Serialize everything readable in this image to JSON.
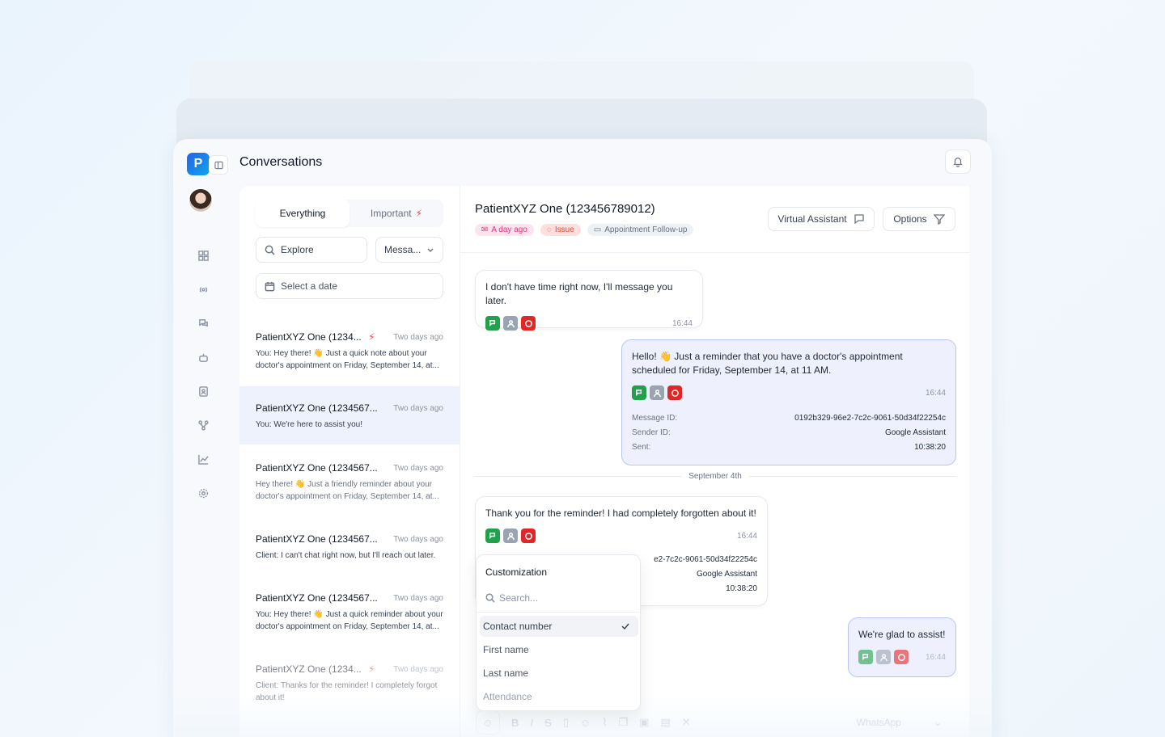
{
  "header": {
    "title": "Conversations",
    "logo_letter": "P"
  },
  "tabs": [
    {
      "label": "Everything"
    },
    {
      "label": "Important"
    }
  ],
  "filters": {
    "explore_label": "Explore",
    "message_select": "Messa...",
    "date_placeholder": "Select a date"
  },
  "conversations": [
    {
      "name": "PatientXYZ One (1234...",
      "time": "Two days ago",
      "important": true,
      "preview": "You: Hey there! 👋 Just a quick note about your doctor's appointment on Friday, September 14, at..."
    },
    {
      "name": "PatientXYZ One (1234567...",
      "time": "Two days ago",
      "important": false,
      "preview": "You: We're here to assist you!"
    },
    {
      "name": "PatientXYZ One (1234567...",
      "time": "Two days ago",
      "important": false,
      "preview": "Hey there! 👋 Just a friendly reminder about your doctor's appointment on Friday, September 14, at..."
    },
    {
      "name": "PatientXYZ One (1234567...",
      "time": "Two days ago",
      "important": false,
      "preview": "Client: I can't chat right now, but I'll reach out later."
    },
    {
      "name": "PatientXYZ One (1234567...",
      "time": "Two days ago",
      "important": false,
      "preview": "You: Hey there! 👋 Just a quick reminder about your doctor's appointment on Friday, September 14, at..."
    },
    {
      "name": "PatientXYZ One (1234...",
      "time": "Two days ago",
      "important": true,
      "preview": "Client: Thanks for the reminder! I completely forgot about it!"
    }
  ],
  "chat": {
    "title": "PatientXYZ One (123456789012)",
    "tags": [
      "A day ago",
      "Issue",
      "Appointment Follow-up"
    ],
    "virtual_assistant_label": "Virtual Assistant",
    "options_label": "Options",
    "date_separator": "September 4th",
    "messages": [
      {
        "text": "I don't have time right now, I'll message you later.",
        "time": "16:44"
      },
      {
        "text": "Hello! 👋 Just a reminder that you have a doctor's appointment scheduled for Friday, September 14, at 11 AM.",
        "time": "16:44",
        "meta": [
          {
            "k": "Message ID:",
            "v": "0192b329-96e2-7c2c-9061-50d34f22254c"
          },
          {
            "k": "Sender ID:",
            "v": "Google Assistant"
          },
          {
            "k": "Sent:",
            "v": "10:38:20"
          }
        ]
      },
      {
        "text": "Thank you for the reminder! I had completely forgotten about it!",
        "time": "16:44",
        "meta_partial": [
          "e2-7c2c-9061-50d34f22254c",
          "Google Assistant",
          "10:38:20"
        ]
      },
      {
        "text": "We're glad to assist!",
        "time": "16:44"
      }
    ]
  },
  "dropdown": {
    "title": "Customization",
    "search_placeholder": "Search...",
    "items": [
      {
        "label": "Contact number",
        "selected": true
      },
      {
        "label": "First name",
        "selected": false
      },
      {
        "label": "Last name",
        "selected": false
      },
      {
        "label": "Attendance",
        "selected": false
      }
    ]
  },
  "composer": {
    "channel": "WhatsApp"
  },
  "colors": {
    "accent": "#2563eb",
    "important": "#ef4444",
    "outgoing_border": "#b9c4f3"
  }
}
